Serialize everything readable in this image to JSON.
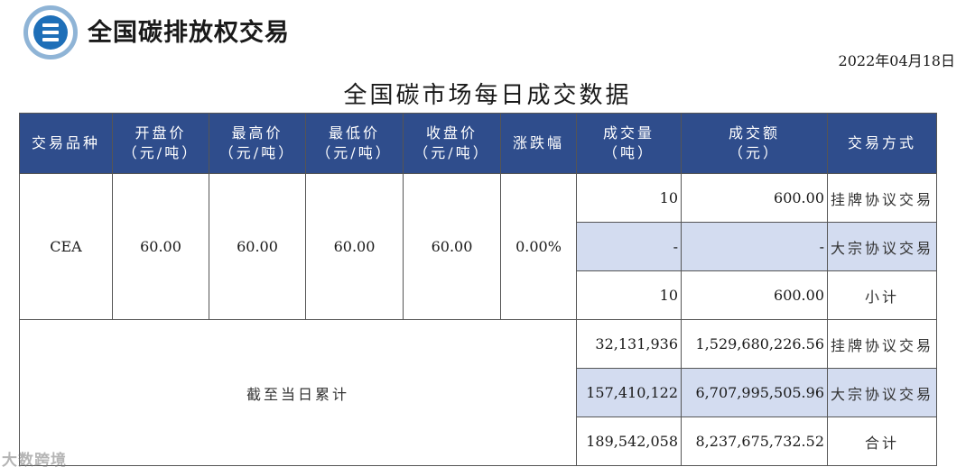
{
  "brand": {
    "name": "全国碳排放权交易",
    "logo_icon": "carbon-exchange-logo-icon"
  },
  "date": "2022年04月18日",
  "title": "全国碳市场每日成交数据",
  "headers": {
    "product": "交易品种",
    "open": [
      "开盘价",
      "（元/吨）"
    ],
    "high": [
      "最高价",
      "（元/吨）"
    ],
    "low": [
      "最低价",
      "（元/吨）"
    ],
    "close": [
      "收盘价",
      "（元/吨）"
    ],
    "change": "涨跌幅",
    "volume": [
      "成交量",
      "（吨）"
    ],
    "amount": [
      "成交额",
      "（元）"
    ],
    "method": "交易方式"
  },
  "daily": {
    "product": "CEA",
    "open": "60.00",
    "high": "60.00",
    "low": "60.00",
    "close": "60.00",
    "change": "0.00%",
    "rows": [
      {
        "volume": "10",
        "amount": "600.00",
        "method": "挂牌协议交易"
      },
      {
        "volume": "-",
        "amount": "-",
        "method": "大宗协议交易"
      },
      {
        "volume": "10",
        "amount": "600.00",
        "method": "小计"
      }
    ]
  },
  "cumulative": {
    "label": "截至当日累计",
    "rows": [
      {
        "volume": "32,131,936",
        "amount": "1,529,680,226.56",
        "method": "挂牌协议交易"
      },
      {
        "volume": "157,410,122",
        "amount": "6,707,995,505.96",
        "method": "大宗协议交易"
      },
      {
        "volume": "189,542,058",
        "amount": "8,237,675,732.52",
        "method": "合计"
      }
    ]
  },
  "watermark": "大数跨境",
  "colors": {
    "header_bg": "#2f4d8c",
    "shaded_row": "#d3dcf0"
  }
}
